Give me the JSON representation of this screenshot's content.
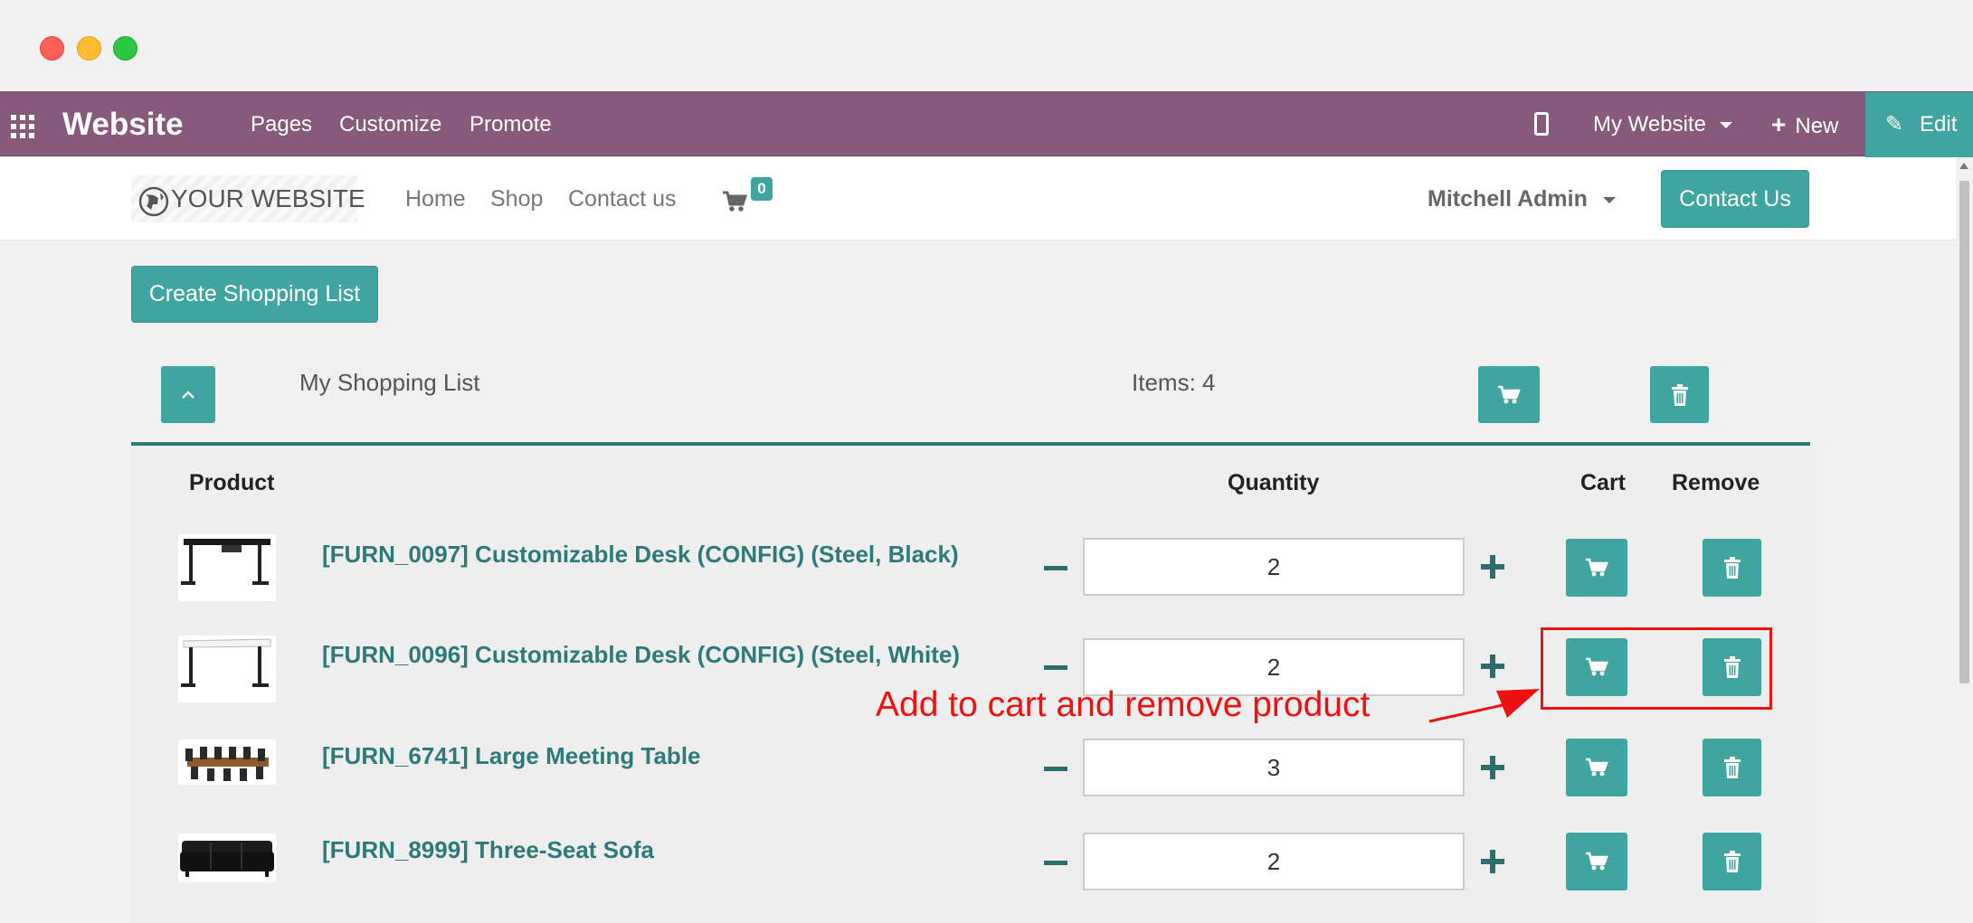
{
  "window": {
    "controls": [
      {
        "name": "close",
        "color": "#fe5f57"
      },
      {
        "name": "minimize",
        "color": "#febc2e"
      },
      {
        "name": "maximize",
        "color": "#28c840"
      }
    ]
  },
  "topbar": {
    "app_name": "Website",
    "menu": [
      "Pages",
      "Customize",
      "Promote"
    ],
    "website_selector": "My Website",
    "new_label": "New",
    "edit_label": "Edit",
    "color": "#875a7b"
  },
  "site_nav": {
    "logo_text": "YOUR WEBSITE",
    "links": [
      "Home",
      "Shop",
      "Contact us"
    ],
    "cart_count": "0",
    "user": "Mitchell Admin",
    "contact_button": "Contact Us"
  },
  "shopping": {
    "create_button": "Create Shopping List",
    "list_name": "My Shopping List",
    "items_label": "Items: 4",
    "columns": {
      "product": "Product",
      "quantity": "Quantity",
      "cart": "Cart",
      "remove": "Remove"
    },
    "rows": [
      {
        "name": "[FURN_0097] Customizable Desk (CONFIG) (Steel, Black)",
        "qty": "2"
      },
      {
        "name": "[FURN_0096] Customizable Desk (CONFIG) (Steel, White)",
        "qty": "2"
      },
      {
        "name": "[FURN_6741] Large Meeting Table",
        "qty": "3"
      },
      {
        "name": "[FURN_8999] Three-Seat Sofa",
        "qty": "2"
      }
    ],
    "accent": "#40a4a0"
  },
  "annotation": {
    "text": "Add to cart and remove product",
    "color": "#ee1111"
  }
}
